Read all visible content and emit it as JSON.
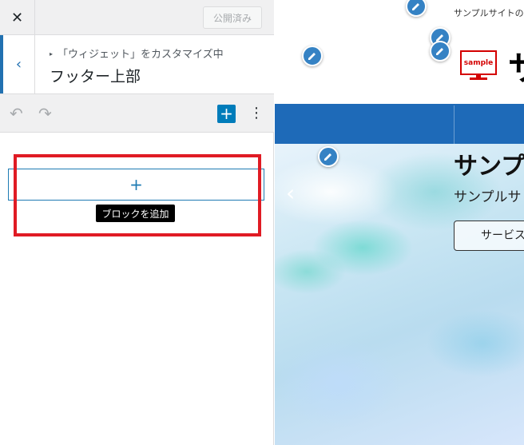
{
  "panel": {
    "close_label": "✕",
    "publish_label": "公開済み",
    "breadcrumb": "「ウィジェット」をカスタマイズ中",
    "section_title": "フッター上部",
    "back_label": "‹",
    "undo_label": "↶",
    "redo_label": "↷",
    "add_block_icon_label": "+",
    "more_label": "⋮",
    "block_appender_label": "+",
    "tooltip": "ブロックを追加"
  },
  "preview": {
    "tagline": "サンプルサイトの",
    "logo_text": "sample",
    "site_title": "サ",
    "hero_heading": "サンプ",
    "hero_subtitle": "サンプルサ",
    "hero_button": "サービス",
    "slider_prev": "‹"
  },
  "colors": {
    "accent": "#007cba",
    "wp_blue": "#2271b1",
    "nav_blue": "#1e6ab8",
    "highlight_red": "#e01b24",
    "logo_red": "#d40000"
  },
  "icons": [
    "close-icon",
    "chevron-left-icon",
    "undo-icon",
    "redo-icon",
    "plus-icon",
    "more-vertical-icon",
    "pencil-icon"
  ]
}
